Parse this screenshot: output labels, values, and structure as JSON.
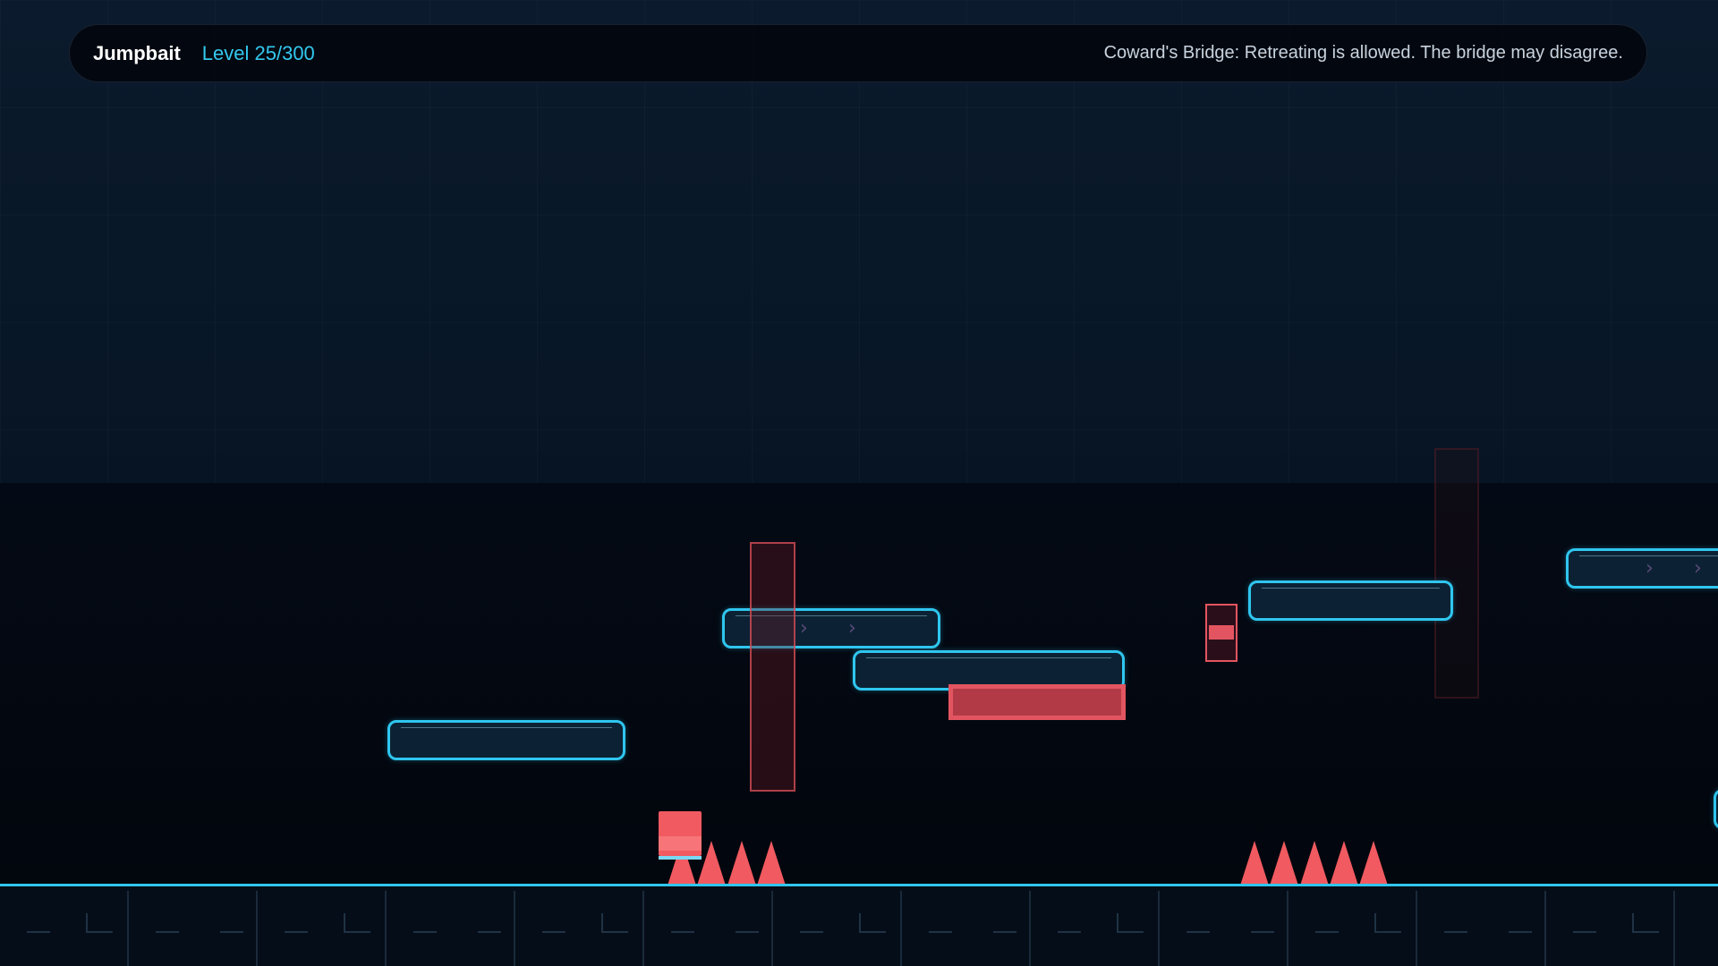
{
  "hud": {
    "game_title": "Jumpbait",
    "level": "Level 25/300",
    "hint": "Coward's Bridge: Retreating is allowed. The bridge may disagree."
  },
  "colors": {
    "platform_outline": "#2fc6ef",
    "platform_fill": "#0c2234",
    "hazard_red": "#f05a60",
    "conveyor_arrow": "#5a4a7a",
    "level_text": "#33c8ef"
  },
  "icons": {
    "conveyor_arrow": "chevron-right-icon",
    "spike": "spike-icon"
  }
}
